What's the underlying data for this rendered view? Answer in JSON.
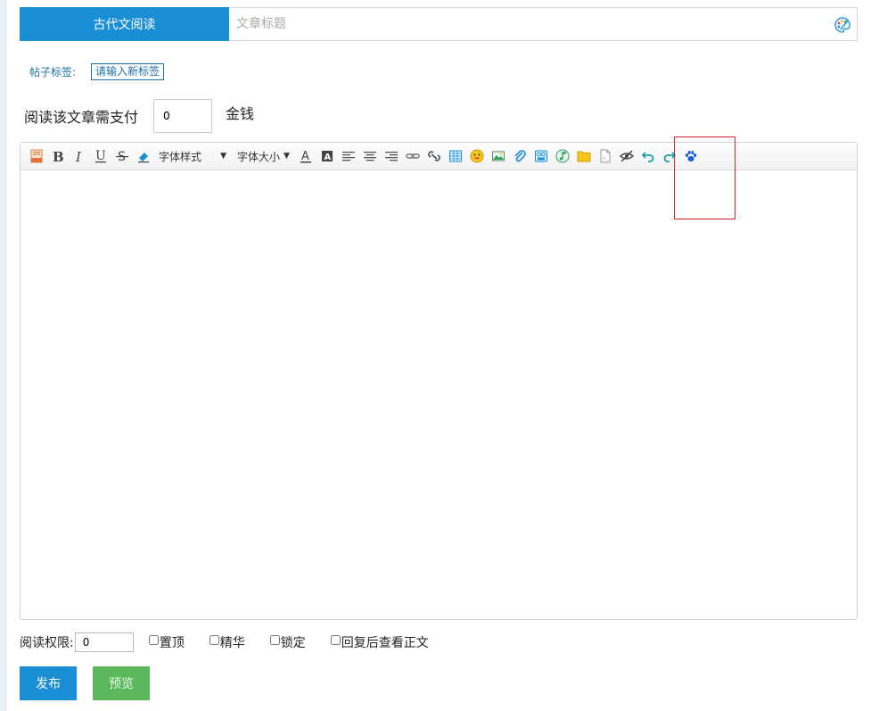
{
  "header": {
    "category_label": "古代文阅读",
    "title_placeholder": "文章标题"
  },
  "tags": {
    "label": "帖子标签:",
    "input_text": "请输入新标签"
  },
  "pay": {
    "label": "阅读该文章需支付",
    "value": "0",
    "unit": "金钱"
  },
  "toolbar": {
    "font_style_label": "字体样式",
    "font_size_label": "字体大小",
    "dropdown_arrow": "▼",
    "icons": [
      "source-icon",
      "bold-icon",
      "italic-icon",
      "underline-icon",
      "strikethrough-icon",
      "eraser-icon",
      "font-color-icon",
      "background-color-icon",
      "align-left-icon",
      "align-center-icon",
      "align-right-icon",
      "link-icon",
      "unlink-icon",
      "table-icon",
      "emoticon-icon",
      "image-icon",
      "attachment-icon",
      "video-icon",
      "music-icon",
      "folder-icon",
      "file-icon",
      "hide-icon",
      "undo-icon",
      "redo-icon",
      "paw-icon"
    ],
    "colors": {
      "blue": "#1a8fd6",
      "yellow": "#f5c518",
      "green": "#2aa05a",
      "teal": "#1aa0a8"
    }
  },
  "options": {
    "permission_label": "阅读权限:",
    "permission_value": "0",
    "checkboxes": [
      "置顶",
      "精华",
      "锁定",
      "回复后查看正文"
    ]
  },
  "actions": {
    "publish_label": "发布",
    "preview_label": "预览"
  }
}
